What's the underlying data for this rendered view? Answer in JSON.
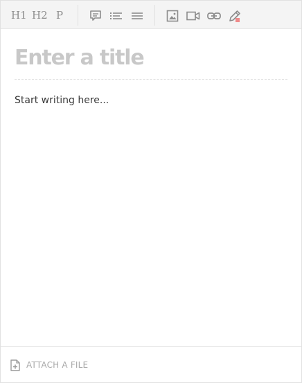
{
  "toolbar": {
    "h1_label": "H1",
    "h2_label": "H2",
    "p_label": "P",
    "icons": [
      "quote-icon",
      "bulleted-list-icon",
      "separator-lines-icon",
      "image-icon",
      "video-icon",
      "link-icon",
      "pencil-icon"
    ],
    "accent_color": "#ef8a8a"
  },
  "editor": {
    "title_placeholder": "Enter a title",
    "body_placeholder": "Start writing here..."
  },
  "footer": {
    "attach_label": "ATTACH A FILE"
  }
}
